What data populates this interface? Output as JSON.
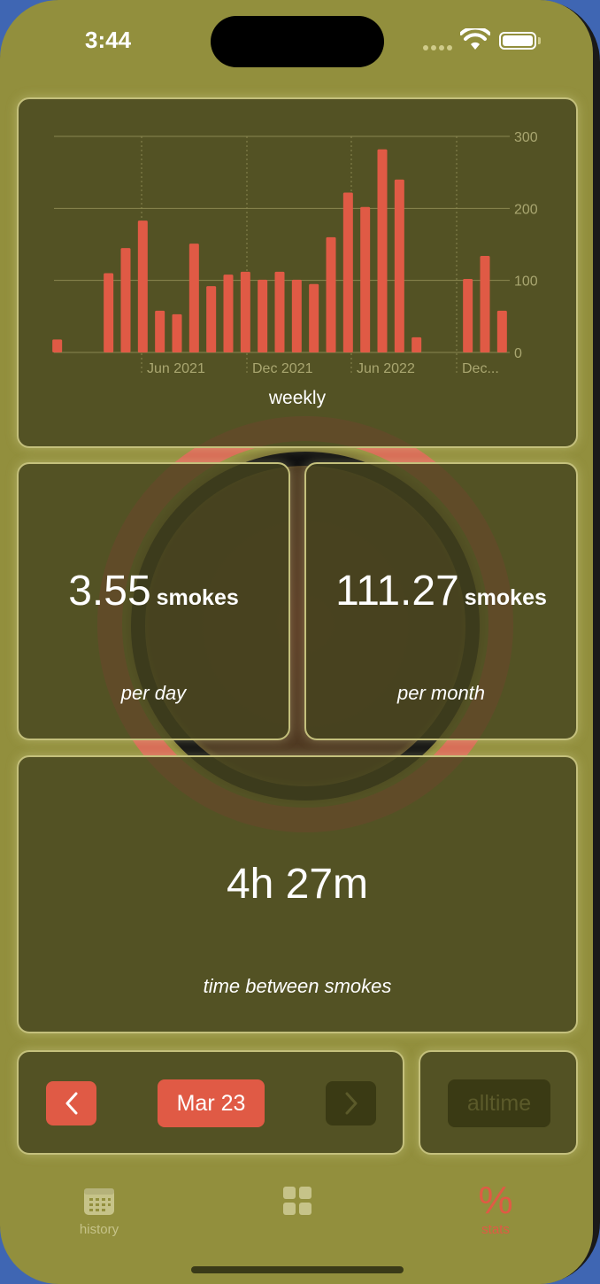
{
  "status_bar": {
    "time": "3:44"
  },
  "chart_data": {
    "type": "bar",
    "title": "weekly",
    "xlabel": "",
    "ylabel": "",
    "ylim": [
      0,
      300
    ],
    "yticks": [
      0,
      100,
      200,
      300
    ],
    "x_tick_labels": [
      "Jun 2021",
      "Dec 2021",
      "Jun 2022",
      "Dec..."
    ],
    "color": "#e05a45",
    "values": [
      18,
      null,
      null,
      110,
      145,
      183,
      58,
      53,
      151,
      92,
      108,
      112,
      101,
      112,
      101,
      95,
      160,
      222,
      202,
      282,
      240,
      21,
      null,
      null,
      102,
      134,
      58
    ]
  },
  "per_day": {
    "value": "3.55",
    "unit": "smokes",
    "label": "per day"
  },
  "per_month": {
    "value": "111.27",
    "unit": "smokes",
    "label": "per month"
  },
  "time_between": {
    "value": "4h 27m",
    "label": "time between smokes"
  },
  "navigator": {
    "prev_icon": "chevron-left-icon",
    "date_label": "Mar 23",
    "next_icon": "chevron-right-icon",
    "mode_label": "alltime"
  },
  "tabbar": {
    "history_label": "history",
    "history_icon": "calendar-icon",
    "grid_icon": "grid-icon",
    "stats_label": "stats",
    "stats_icon": "percent-icon",
    "stats_symbol": "%"
  },
  "colors": {
    "background": "#928f3d",
    "card": "#46441e",
    "accent": "#e05a45"
  }
}
